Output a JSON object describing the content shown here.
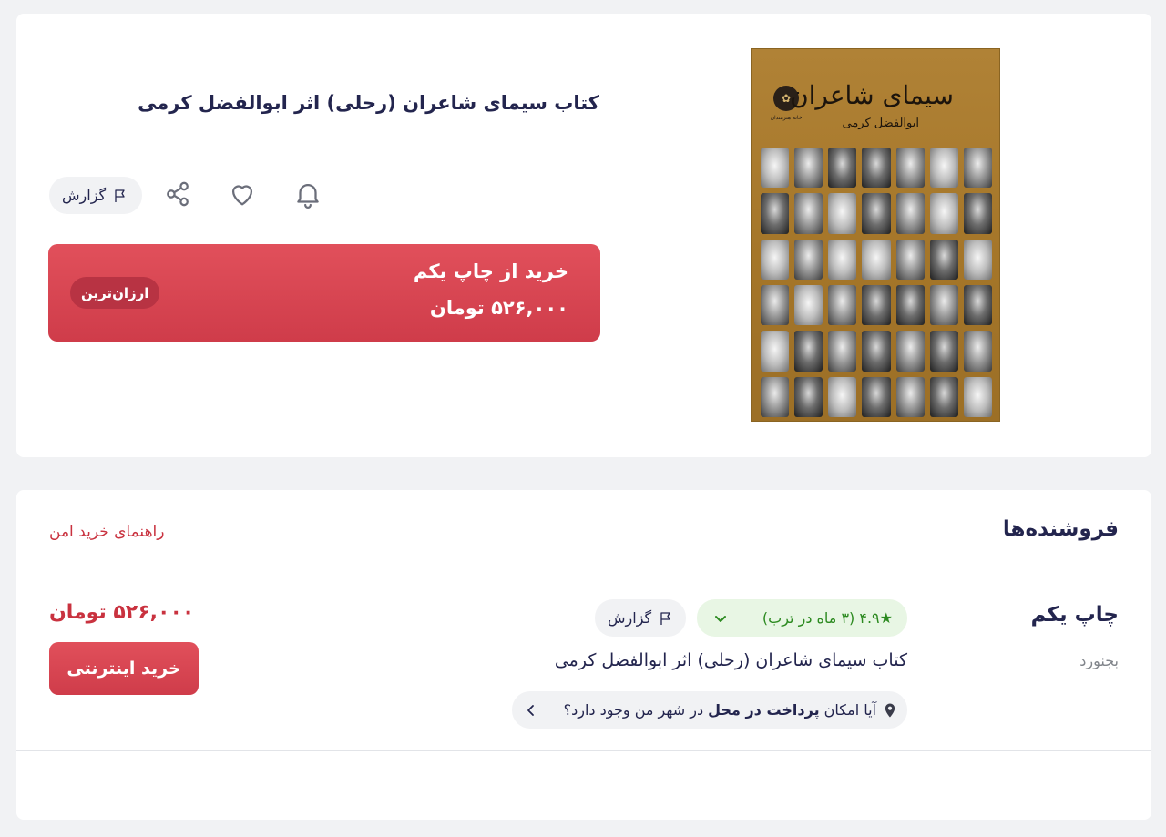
{
  "product": {
    "title": "کتاب سیمای شاعران (رحلی) اثر ابوالفضل کرمی",
    "cover": {
      "title": "سیمای شاعران",
      "author": "ابوالفضل کرمی",
      "publisher_logo": "خانه هنرمندان"
    },
    "actions": {
      "notify_icon": "bell-icon",
      "favorite_icon": "heart-icon",
      "share_icon": "share-icon",
      "report_label": "گزارش",
      "report_icon": "flag-icon"
    },
    "buy_box": {
      "title": "خرید از چاپ یکم",
      "price": "۵۲۶,۰۰۰ تومان",
      "badge": "ارزان‌ترین"
    }
  },
  "sellers": {
    "heading": "فروشنده‌ها",
    "guide_link": "راهنمای خرید امن",
    "items": [
      {
        "name": "چاپ یکم",
        "city": "بجنورد",
        "rating": "★۴.۹ (۳ ماه در ترب)",
        "report_label": "گزارش",
        "product_title": "کتاب سیمای شاعران (رحلی) اثر ابوالفضل کرمی",
        "cod_question_pre": "آیا امکان ",
        "cod_question_bold": "پرداخت در محل",
        "cod_question_post": " در شهر من وجود دارد؟",
        "price": "۵۲۶,۰۰۰ تومان",
        "buy_label": "خرید اینترنتی"
      }
    ]
  },
  "colors": {
    "accent": "#d3404d",
    "text": "#23254e",
    "rating_green": "#2c8a20",
    "background": "#f1f2f4"
  }
}
